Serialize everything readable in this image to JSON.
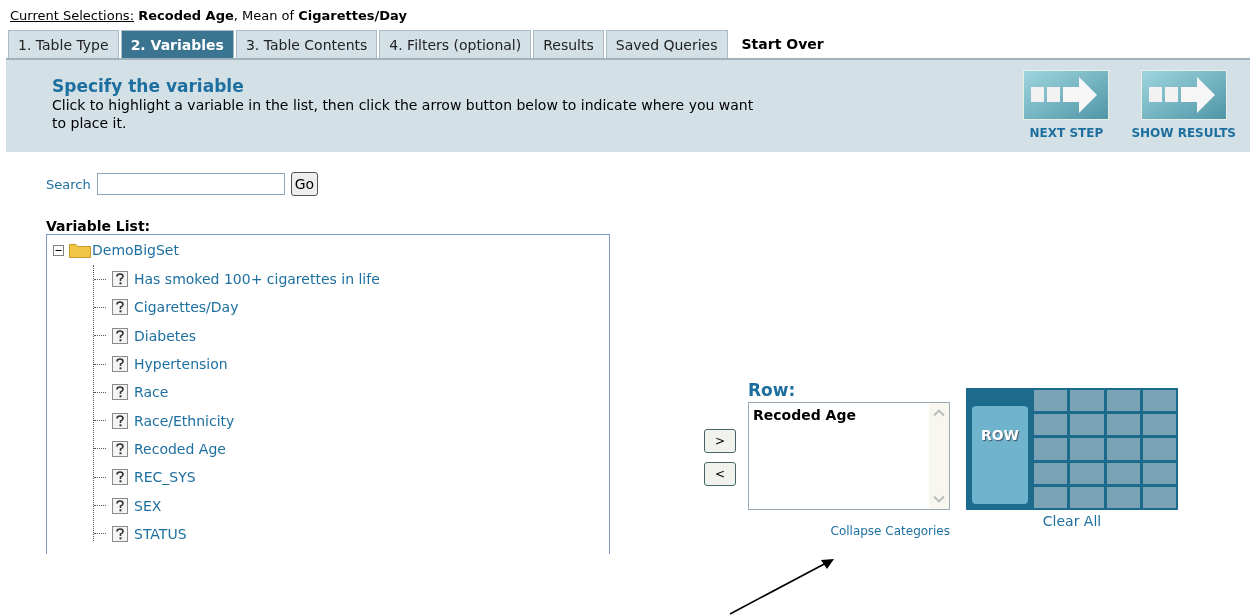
{
  "current_selections": {
    "label": "Current Selections:",
    "value": "**Recoded Age**, Mean of **Cigarettes/Day**"
  },
  "tabs": [
    {
      "label": "1. Table Type",
      "kind": "tab",
      "selected": false
    },
    {
      "label": "2. Variables",
      "kind": "tab",
      "selected": true
    },
    {
      "label": "3. Table Contents",
      "kind": "tab",
      "selected": false
    },
    {
      "label": "4. Filters (optional)",
      "kind": "tab",
      "selected": false
    },
    {
      "label": "Results",
      "kind": "tab",
      "selected": false
    },
    {
      "label": "Saved Queries",
      "kind": "tab",
      "selected": false
    },
    {
      "label": "Start Over",
      "kind": "link",
      "selected": false
    }
  ],
  "header": {
    "title": "Specify the variable",
    "description": "Click to highlight a variable in the list, then click the arrow button below to indicate where you want to place it.",
    "buttons": [
      {
        "label": "NEXT STEP"
      },
      {
        "label": "SHOW RESULTS"
      }
    ]
  },
  "search": {
    "label": "Search",
    "button": "Go"
  },
  "variable_list": {
    "label": "Variable List:",
    "tree": {
      "label": "DemoBigSet",
      "expanded": true,
      "children": [
        {
          "label": "Has smoked 100+ cigarettes in life"
        },
        {
          "label": "Cigarettes/Day"
        },
        {
          "label": "Diabetes"
        },
        {
          "label": "Hypertension"
        },
        {
          "label": "Race"
        },
        {
          "label": "Race/Ethnicity"
        },
        {
          "label": "Recoded Age"
        },
        {
          "label": "REC_SYS"
        },
        {
          "label": "SEX"
        },
        {
          "label": "STATUS"
        }
      ]
    }
  },
  "move_buttons": [
    ">",
    "<"
  ],
  "row": {
    "label": "Row:",
    "items": [
      "Recoded Age"
    ],
    "link": "Collapse Categories"
  },
  "layout_grid": {
    "highlight": "ROW",
    "link": "Clear All"
  }
}
